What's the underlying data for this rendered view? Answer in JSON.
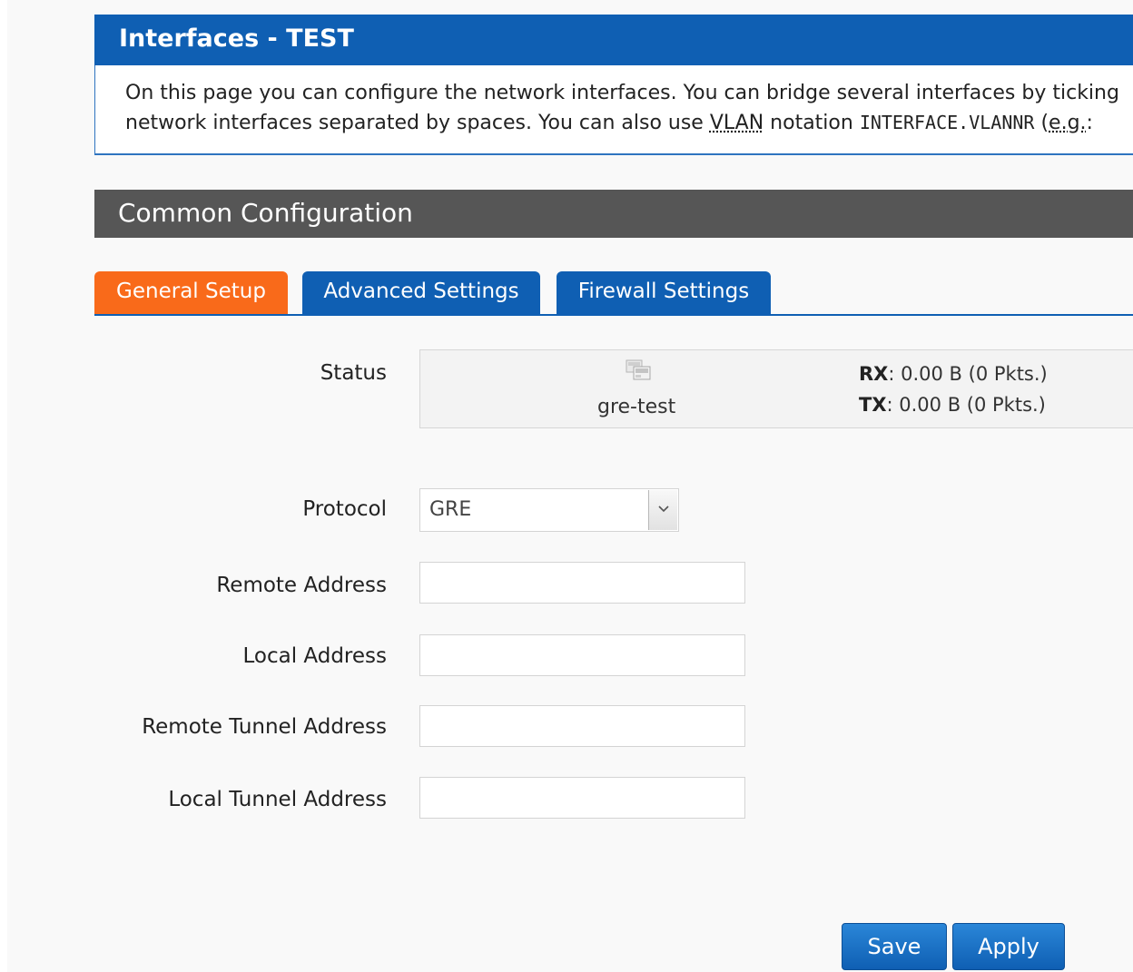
{
  "header": {
    "title": "Interfaces - TEST"
  },
  "description": {
    "line1": "On this page you can configure the network interfaces. You can bridge several interfaces by ticking",
    "line2_before_vlan": "network interfaces separated by spaces. You can also use ",
    "vlan_abbr": "VLAN",
    "line2_after_vlan": " notation ",
    "code": "INTERFACE.VLANNR",
    "line2_end": " (",
    "eg_abbr": "e.g.",
    "line2_tail": ": "
  },
  "section": {
    "title": "Common Configuration"
  },
  "tabs": [
    {
      "label": "General Setup",
      "active": true
    },
    {
      "label": "Advanced Settings",
      "active": false
    },
    {
      "label": "Firewall Settings",
      "active": false
    }
  ],
  "status": {
    "label": "Status",
    "icon": "network-interface-icon",
    "interface_name": "gre-test",
    "rx_label": "RX",
    "rx_value": ": 0.00 B (0 Pkts.)",
    "tx_label": "TX",
    "tx_value": ": 0.00 B (0 Pkts.)"
  },
  "form": {
    "protocol": {
      "label": "Protocol",
      "value": "GRE"
    },
    "remote_address": {
      "label": "Remote Address",
      "value": ""
    },
    "local_address": {
      "label": "Local Address",
      "value": ""
    },
    "remote_tunnel_address": {
      "label": "Remote Tunnel Address",
      "value": ""
    },
    "local_tunnel_address": {
      "label": "Local Tunnel Address",
      "value": ""
    }
  },
  "buttons": {
    "save": "Save",
    "apply": "Apply"
  },
  "colors": {
    "header_blue": "#0f5fb3",
    "active_tab_orange": "#f96a1a",
    "section_gray": "#565656"
  }
}
